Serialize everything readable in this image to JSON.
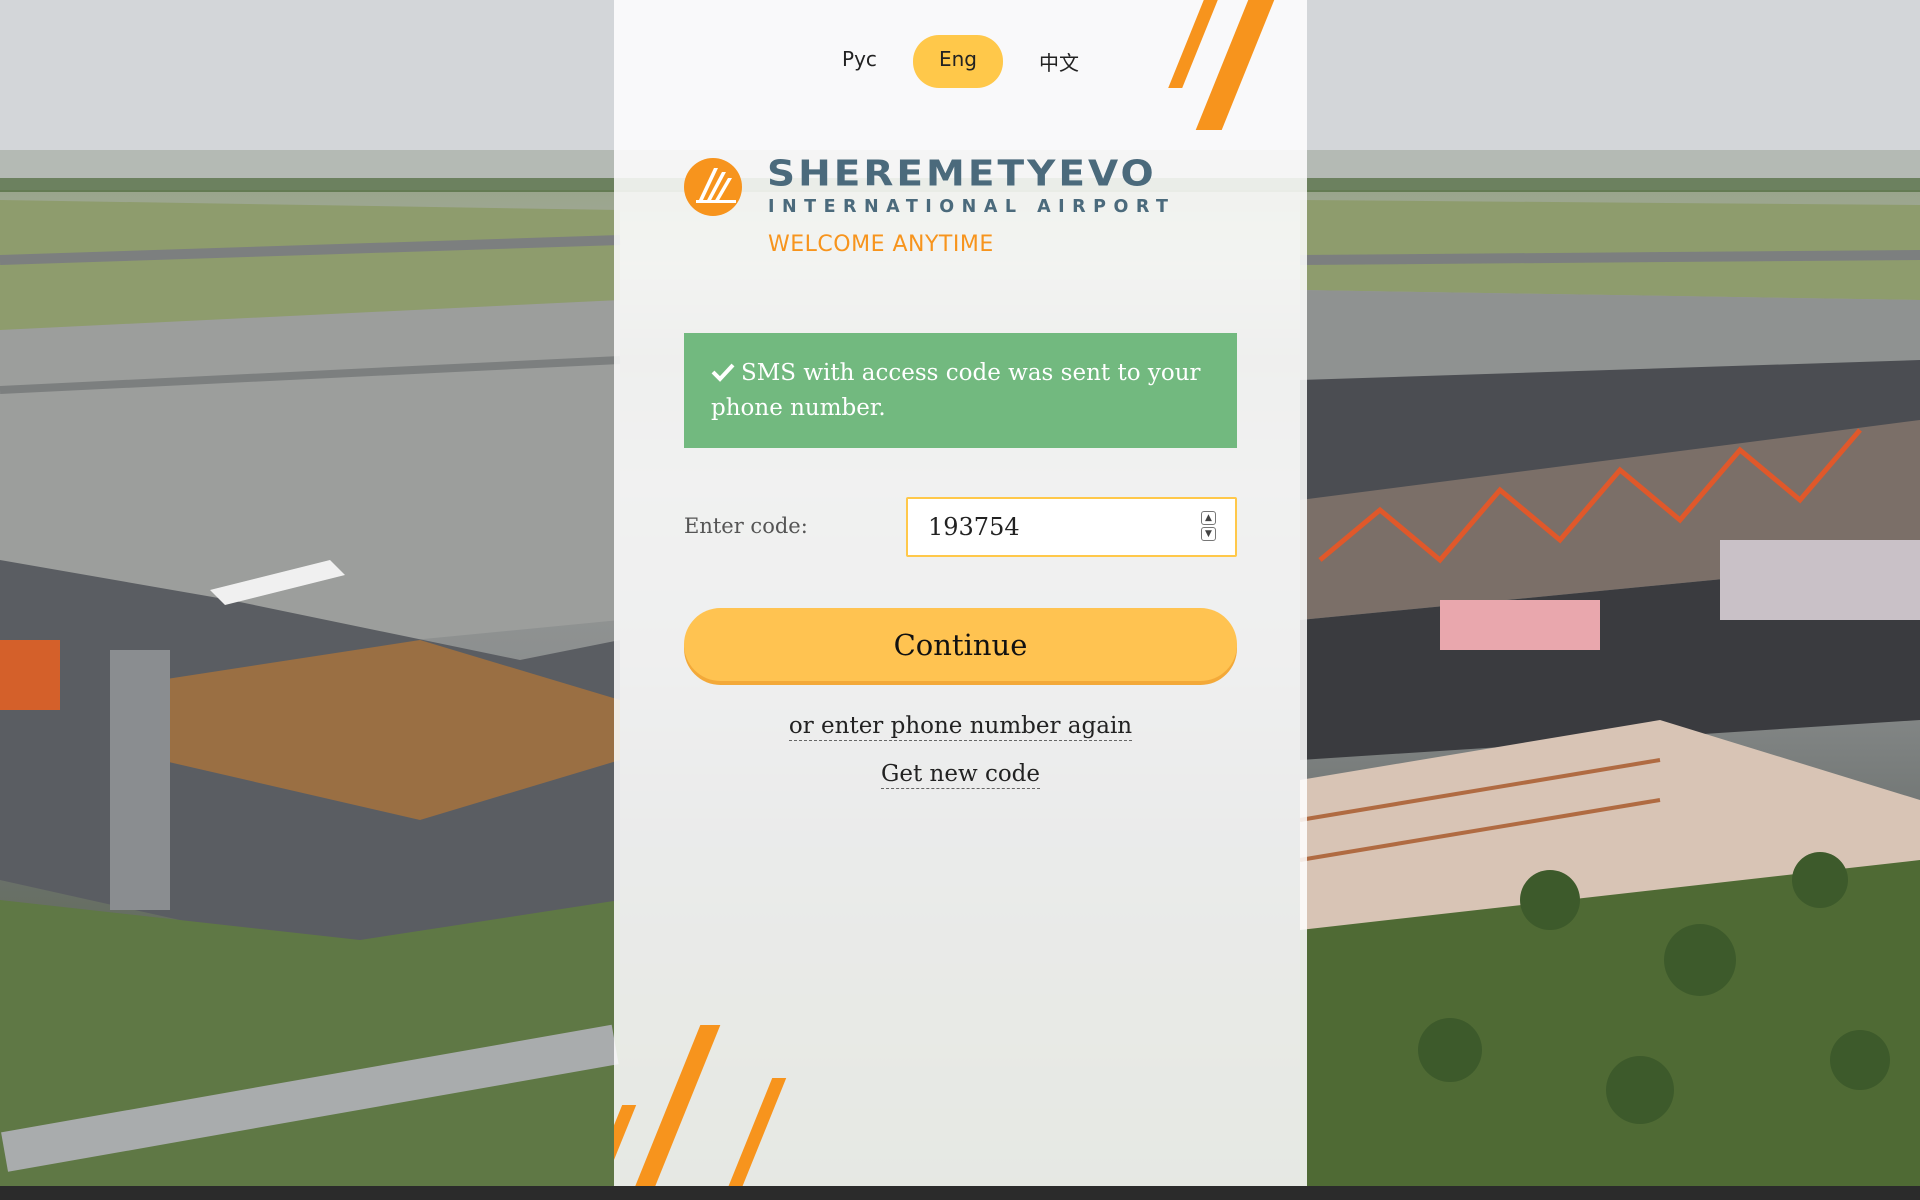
{
  "languages": [
    {
      "label": "Рус",
      "active": false
    },
    {
      "label": "Eng",
      "active": true
    },
    {
      "label": "中文",
      "active": false
    }
  ],
  "logo": {
    "title": "SHEREMETYEVO",
    "subtitle": "INTERNATIONAL AIRPORT",
    "tagline": "WELCOME ANYTIME"
  },
  "alert": {
    "icon": "check-icon",
    "message": "SMS with access code was sent to your phone number."
  },
  "code_form": {
    "label": "Enter code:",
    "value": "193754",
    "continue_label": "Continue"
  },
  "links": {
    "reenter_phone": "or enter phone number again",
    "new_code": "Get new code"
  },
  "colors": {
    "accent": "#ffc84a",
    "brand_orange": "#f7941d",
    "success": "#72b97f",
    "brand_text": "#4b6a7c"
  }
}
